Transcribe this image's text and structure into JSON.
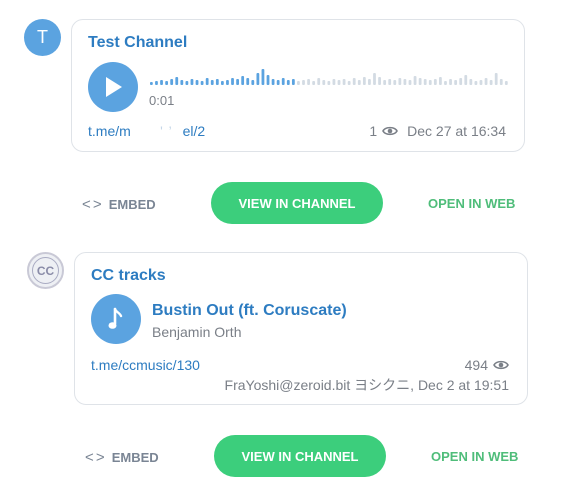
{
  "posts": [
    {
      "avatar_letter": "T",
      "channel_name": "Test Channel",
      "voice": {
        "duration": "0:01",
        "played_fraction": 0.4
      },
      "link": "t.me/m... ´‘’...el/2",
      "link_visible": "t.me/m",
      "link_tail": "el/2",
      "views": "1",
      "date": "Dec 27 at 16:34"
    },
    {
      "avatar_letter": "CC",
      "channel_name": "CC tracks",
      "audio": {
        "title": "Bustin Out (ft. Coruscate)",
        "artist": "Benjamin Orth"
      },
      "link": "t.me/ccmusic/130",
      "views": "494",
      "author_date": "FraYoshi@zeroid.bit ヨシクニ, Dec 2 at 19:51"
    }
  ],
  "actions": {
    "embed_label": "EMBED",
    "embed_icon": "< >",
    "view_label": "VIEW IN CHANNEL",
    "open_label": "OPEN IN WEB"
  },
  "colors": {
    "accent_blue": "#2d7cc1",
    "avatar_blue": "#5ba3e0",
    "green": "#3cce7c",
    "muted": "#7a7f87"
  },
  "icons": {
    "play": "play-icon",
    "music": "music-note-icon",
    "views": "eye-icon",
    "embed": "code-brackets-icon"
  }
}
